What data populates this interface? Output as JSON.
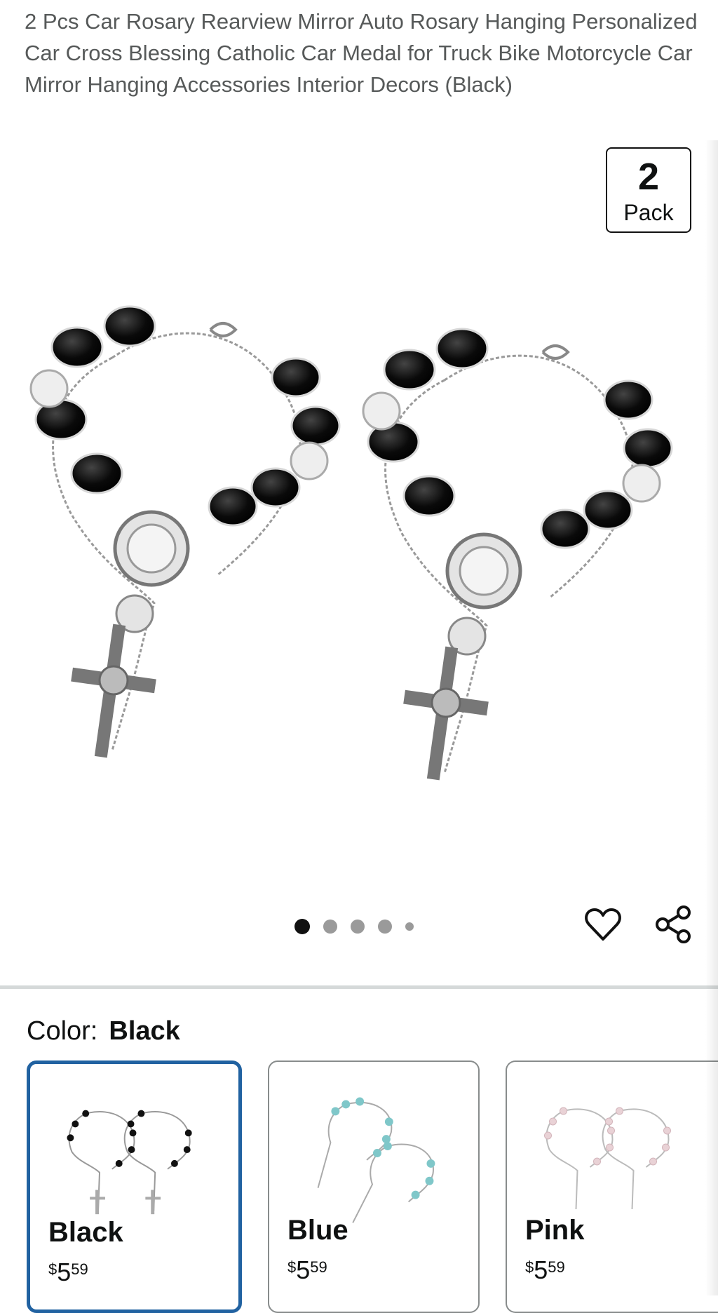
{
  "product": {
    "title": "2 Pcs Car Rosary Rearview Mirror Auto Rosary Hanging Personalized Car Cross Blessing Catholic Car Medal for Truck Bike Motorcycle Car Mirror Hanging Accessories Interior Decors (Black)"
  },
  "gallery": {
    "badge_number": "2",
    "badge_label": "Pack",
    "image_count": 5,
    "active_index": 0
  },
  "actions": {
    "wishlist_icon": "heart-icon",
    "share_icon": "share-icon"
  },
  "variants": {
    "label": "Color:",
    "selected_value": "Black",
    "options": [
      {
        "name": "Black",
        "currency": "$",
        "dollars": "5",
        "cents": "59",
        "bead_color": "#111111",
        "selected": true
      },
      {
        "name": "Blue",
        "currency": "$",
        "dollars": "5",
        "cents": "59",
        "bead_color": "#7fc7c9",
        "selected": false
      },
      {
        "name": "Pink",
        "currency": "$",
        "dollars": "5",
        "cents": "59",
        "bead_color": "#e9d2d6",
        "selected": false
      }
    ]
  }
}
